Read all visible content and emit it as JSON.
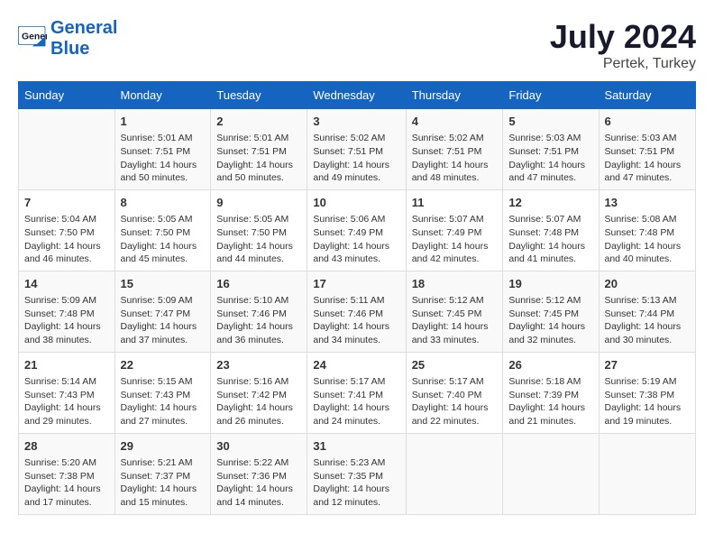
{
  "header": {
    "logo_line1": "General",
    "logo_line2": "Blue",
    "month_year": "July 2024",
    "location": "Pertek, Turkey"
  },
  "days_of_week": [
    "Sunday",
    "Monday",
    "Tuesday",
    "Wednesday",
    "Thursday",
    "Friday",
    "Saturday"
  ],
  "weeks": [
    [
      {
        "day": "",
        "sunrise": "",
        "sunset": "",
        "daylight": ""
      },
      {
        "day": "1",
        "sunrise": "Sunrise: 5:01 AM",
        "sunset": "Sunset: 7:51 PM",
        "daylight": "Daylight: 14 hours and 50 minutes."
      },
      {
        "day": "2",
        "sunrise": "Sunrise: 5:01 AM",
        "sunset": "Sunset: 7:51 PM",
        "daylight": "Daylight: 14 hours and 50 minutes."
      },
      {
        "day": "3",
        "sunrise": "Sunrise: 5:02 AM",
        "sunset": "Sunset: 7:51 PM",
        "daylight": "Daylight: 14 hours and 49 minutes."
      },
      {
        "day": "4",
        "sunrise": "Sunrise: 5:02 AM",
        "sunset": "Sunset: 7:51 PM",
        "daylight": "Daylight: 14 hours and 48 minutes."
      },
      {
        "day": "5",
        "sunrise": "Sunrise: 5:03 AM",
        "sunset": "Sunset: 7:51 PM",
        "daylight": "Daylight: 14 hours and 47 minutes."
      },
      {
        "day": "6",
        "sunrise": "Sunrise: 5:03 AM",
        "sunset": "Sunset: 7:51 PM",
        "daylight": "Daylight: 14 hours and 47 minutes."
      }
    ],
    [
      {
        "day": "7",
        "sunrise": "Sunrise: 5:04 AM",
        "sunset": "Sunset: 7:50 PM",
        "daylight": "Daylight: 14 hours and 46 minutes."
      },
      {
        "day": "8",
        "sunrise": "Sunrise: 5:05 AM",
        "sunset": "Sunset: 7:50 PM",
        "daylight": "Daylight: 14 hours and 45 minutes."
      },
      {
        "day": "9",
        "sunrise": "Sunrise: 5:05 AM",
        "sunset": "Sunset: 7:50 PM",
        "daylight": "Daylight: 14 hours and 44 minutes."
      },
      {
        "day": "10",
        "sunrise": "Sunrise: 5:06 AM",
        "sunset": "Sunset: 7:49 PM",
        "daylight": "Daylight: 14 hours and 43 minutes."
      },
      {
        "day": "11",
        "sunrise": "Sunrise: 5:07 AM",
        "sunset": "Sunset: 7:49 PM",
        "daylight": "Daylight: 14 hours and 42 minutes."
      },
      {
        "day": "12",
        "sunrise": "Sunrise: 5:07 AM",
        "sunset": "Sunset: 7:48 PM",
        "daylight": "Daylight: 14 hours and 41 minutes."
      },
      {
        "day": "13",
        "sunrise": "Sunrise: 5:08 AM",
        "sunset": "Sunset: 7:48 PM",
        "daylight": "Daylight: 14 hours and 40 minutes."
      }
    ],
    [
      {
        "day": "14",
        "sunrise": "Sunrise: 5:09 AM",
        "sunset": "Sunset: 7:48 PM",
        "daylight": "Daylight: 14 hours and 38 minutes."
      },
      {
        "day": "15",
        "sunrise": "Sunrise: 5:09 AM",
        "sunset": "Sunset: 7:47 PM",
        "daylight": "Daylight: 14 hours and 37 minutes."
      },
      {
        "day": "16",
        "sunrise": "Sunrise: 5:10 AM",
        "sunset": "Sunset: 7:46 PM",
        "daylight": "Daylight: 14 hours and 36 minutes."
      },
      {
        "day": "17",
        "sunrise": "Sunrise: 5:11 AM",
        "sunset": "Sunset: 7:46 PM",
        "daylight": "Daylight: 14 hours and 34 minutes."
      },
      {
        "day": "18",
        "sunrise": "Sunrise: 5:12 AM",
        "sunset": "Sunset: 7:45 PM",
        "daylight": "Daylight: 14 hours and 33 minutes."
      },
      {
        "day": "19",
        "sunrise": "Sunrise: 5:12 AM",
        "sunset": "Sunset: 7:45 PM",
        "daylight": "Daylight: 14 hours and 32 minutes."
      },
      {
        "day": "20",
        "sunrise": "Sunrise: 5:13 AM",
        "sunset": "Sunset: 7:44 PM",
        "daylight": "Daylight: 14 hours and 30 minutes."
      }
    ],
    [
      {
        "day": "21",
        "sunrise": "Sunrise: 5:14 AM",
        "sunset": "Sunset: 7:43 PM",
        "daylight": "Daylight: 14 hours and 29 minutes."
      },
      {
        "day": "22",
        "sunrise": "Sunrise: 5:15 AM",
        "sunset": "Sunset: 7:43 PM",
        "daylight": "Daylight: 14 hours and 27 minutes."
      },
      {
        "day": "23",
        "sunrise": "Sunrise: 5:16 AM",
        "sunset": "Sunset: 7:42 PM",
        "daylight": "Daylight: 14 hours and 26 minutes."
      },
      {
        "day": "24",
        "sunrise": "Sunrise: 5:17 AM",
        "sunset": "Sunset: 7:41 PM",
        "daylight": "Daylight: 14 hours and 24 minutes."
      },
      {
        "day": "25",
        "sunrise": "Sunrise: 5:17 AM",
        "sunset": "Sunset: 7:40 PM",
        "daylight": "Daylight: 14 hours and 22 minutes."
      },
      {
        "day": "26",
        "sunrise": "Sunrise: 5:18 AM",
        "sunset": "Sunset: 7:39 PM",
        "daylight": "Daylight: 14 hours and 21 minutes."
      },
      {
        "day": "27",
        "sunrise": "Sunrise: 5:19 AM",
        "sunset": "Sunset: 7:38 PM",
        "daylight": "Daylight: 14 hours and 19 minutes."
      }
    ],
    [
      {
        "day": "28",
        "sunrise": "Sunrise: 5:20 AM",
        "sunset": "Sunset: 7:38 PM",
        "daylight": "Daylight: 14 hours and 17 minutes."
      },
      {
        "day": "29",
        "sunrise": "Sunrise: 5:21 AM",
        "sunset": "Sunset: 7:37 PM",
        "daylight": "Daylight: 14 hours and 15 minutes."
      },
      {
        "day": "30",
        "sunrise": "Sunrise: 5:22 AM",
        "sunset": "Sunset: 7:36 PM",
        "daylight": "Daylight: 14 hours and 14 minutes."
      },
      {
        "day": "31",
        "sunrise": "Sunrise: 5:23 AM",
        "sunset": "Sunset: 7:35 PM",
        "daylight": "Daylight: 14 hours and 12 minutes."
      },
      {
        "day": "",
        "sunrise": "",
        "sunset": "",
        "daylight": ""
      },
      {
        "day": "",
        "sunrise": "",
        "sunset": "",
        "daylight": ""
      },
      {
        "day": "",
        "sunrise": "",
        "sunset": "",
        "daylight": ""
      }
    ]
  ]
}
